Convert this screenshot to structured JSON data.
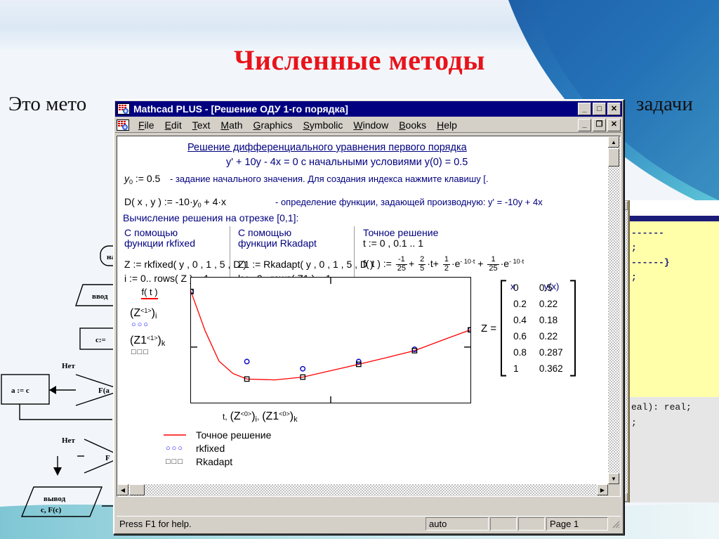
{
  "slide": {
    "title": "Численные методы",
    "body_left": "Это мето",
    "body_right": "задачи",
    "title_color": "#e8131a"
  },
  "flowchart": {
    "nodes": [
      {
        "name": "start",
        "text": "на"
      },
      {
        "name": "input",
        "text": "ввод"
      },
      {
        "name": "assign-c",
        "text": "c:="
      },
      {
        "name": "assign-a",
        "text": "a := c"
      },
      {
        "name": "decision-1",
        "text": "F(a"
      },
      {
        "name": "decision-2",
        "text": "F"
      },
      {
        "name": "output",
        "text": "вывод"
      },
      {
        "name": "output-2",
        "text": "c, F(c)"
      }
    ],
    "labels": [
      "Нет",
      "Нет"
    ]
  },
  "code_window": {
    "yellow_lines": [
      "------",
      "",
      ";",
      "",
      "",
      "------}",
      ";"
    ],
    "grey_lines": [
      "eal): real;",
      "",
      ";"
    ]
  },
  "window": {
    "icon": "mathcad-icon",
    "title": "Mathcad PLUS - [Решение ОДУ 1-го порядка]",
    "buttons": [
      {
        "name": "minimize-button",
        "glyph": "_"
      },
      {
        "name": "maximize-button",
        "glyph": "□"
      },
      {
        "name": "close-button",
        "glyph": "✕"
      }
    ],
    "mdi_buttons": [
      {
        "name": "mdi-minimize-button",
        "glyph": "_"
      },
      {
        "name": "mdi-restore-button",
        "glyph": "❐"
      },
      {
        "name": "mdi-close-button",
        "glyph": "✕"
      }
    ],
    "menu": [
      {
        "name": "menu-file",
        "accel": "F",
        "rest": "ile"
      },
      {
        "name": "menu-edit",
        "accel": "E",
        "rest": "dit"
      },
      {
        "name": "menu-text",
        "accel": "T",
        "rest": "ext"
      },
      {
        "name": "menu-math",
        "accel": "M",
        "rest": "ath"
      },
      {
        "name": "menu-graphics",
        "accel": "G",
        "rest": "raphics"
      },
      {
        "name": "menu-symbolic",
        "accel": "S",
        "rest": "ymbolic"
      },
      {
        "name": "menu-window",
        "accel": "W",
        "rest": "indow"
      },
      {
        "name": "menu-books",
        "accel": "B",
        "rest": "ooks"
      },
      {
        "name": "menu-help",
        "accel": "H",
        "rest": "elp"
      }
    ]
  },
  "statusbar": {
    "help_text": "Press F1 for help.",
    "auto": "auto",
    "blank1": "",
    "blank2": "",
    "page": "Page 1"
  },
  "document": {
    "heading_1": "Решение дифференциального уравнения первого порядка",
    "heading_2": "y' + 10y - 4x = 0 с начальными условиями y(0) = 0.5",
    "y0_value": "0.5",
    "y0_note": "- задание начального значения. Для создания индекса нажмите  клавишу [.",
    "D_note": "- определение функции, задающей производную: y' = -10y + 4x",
    "segment_line": "Вычисление решения на отрезке [0,1]:",
    "columns": [
      {
        "name": "column-rkfixed",
        "header_1": "С помощью",
        "header_2": "функции rkfixed",
        "expr_1": "Z := rkfixed( y , 0 , 1 , 5 , D )",
        "expr_2": "i := 0.. rows( Z ) – 1"
      },
      {
        "name": "column-rkadapt",
        "header_1": "С помощью",
        "header_2": "функции Rkadapt",
        "expr_1": "Z1 := Rkadapt( y , 0 , 1 , 5 , D )",
        "expr_2": "k := 0.. rows( Z1 ) – 1"
      },
      {
        "name": "column-exact",
        "header_1": "Точное решение",
        "header_2": "t := 0 , 0.1 .. 1",
        "expr_1": "f( t ) :=",
        "expr_2": ""
      }
    ],
    "exact_formula": {
      "f1_num": "-1",
      "f1_den": "25",
      "f2_num": "2",
      "f2_den": "5",
      "f2_var": "·t",
      "f3_num": "1",
      "f3_den": "2",
      "f3_exp": "- 10·t",
      "f4_num": "1",
      "f4_den": "25",
      "f4_exp": "- 10·t"
    }
  },
  "matrix": {
    "label": "Z =",
    "col_headers": [
      "x",
      "y(x)"
    ],
    "rows": [
      [
        "0",
        "0.5"
      ],
      [
        "0.2",
        "0.22"
      ],
      [
        "0.4",
        "0.18"
      ],
      [
        "0.6",
        "0.22"
      ],
      [
        "0.8",
        "0.287"
      ],
      [
        "1",
        "0.362"
      ]
    ]
  },
  "chart_data": {
    "type": "line",
    "title": "",
    "xlabel": "t, (Z^<0>)i , (Z1^<0>)k",
    "ylabel": "f(t), (Z^<1>)i , (Z1^<1>)k",
    "xlim": [
      0,
      1
    ],
    "ylim": [
      0.1,
      0.55
    ],
    "grid": false,
    "legend_position": "below",
    "series": [
      {
        "name": "Точное решение",
        "marker": "line",
        "color": "#ff0000",
        "x": [
          0,
          0.05,
          0.1,
          0.15,
          0.2,
          0.3,
          0.4,
          0.5,
          0.6,
          0.7,
          0.8,
          0.9,
          1.0
        ],
        "y": [
          0.5,
          0.36,
          0.25,
          0.205,
          0.185,
          0.182,
          0.192,
          0.215,
          0.238,
          0.262,
          0.287,
          0.325,
          0.362
        ]
      },
      {
        "name": "rkfixed",
        "marker": "circle",
        "color": "#0000cc",
        "x": [
          0,
          0.2,
          0.4,
          0.6,
          0.8,
          1.0
        ],
        "y": [
          0.5,
          0.248,
          0.222,
          0.248,
          0.292,
          0.362
        ]
      },
      {
        "name": "Rkadapt",
        "marker": "square",
        "color": "#000000",
        "x": [
          0,
          0.2,
          0.4,
          0.6,
          0.8,
          1.0
        ],
        "y": [
          0.5,
          0.185,
          0.192,
          0.238,
          0.287,
          0.362
        ]
      }
    ],
    "legend": [
      {
        "label": "Точное решение",
        "key": "line",
        "color": "#ff0000"
      },
      {
        "label": "rkfixed",
        "key": "circles",
        "color": "#0000cc"
      },
      {
        "label": "Rkadapt",
        "key": "squares",
        "color": "#000000"
      }
    ]
  }
}
